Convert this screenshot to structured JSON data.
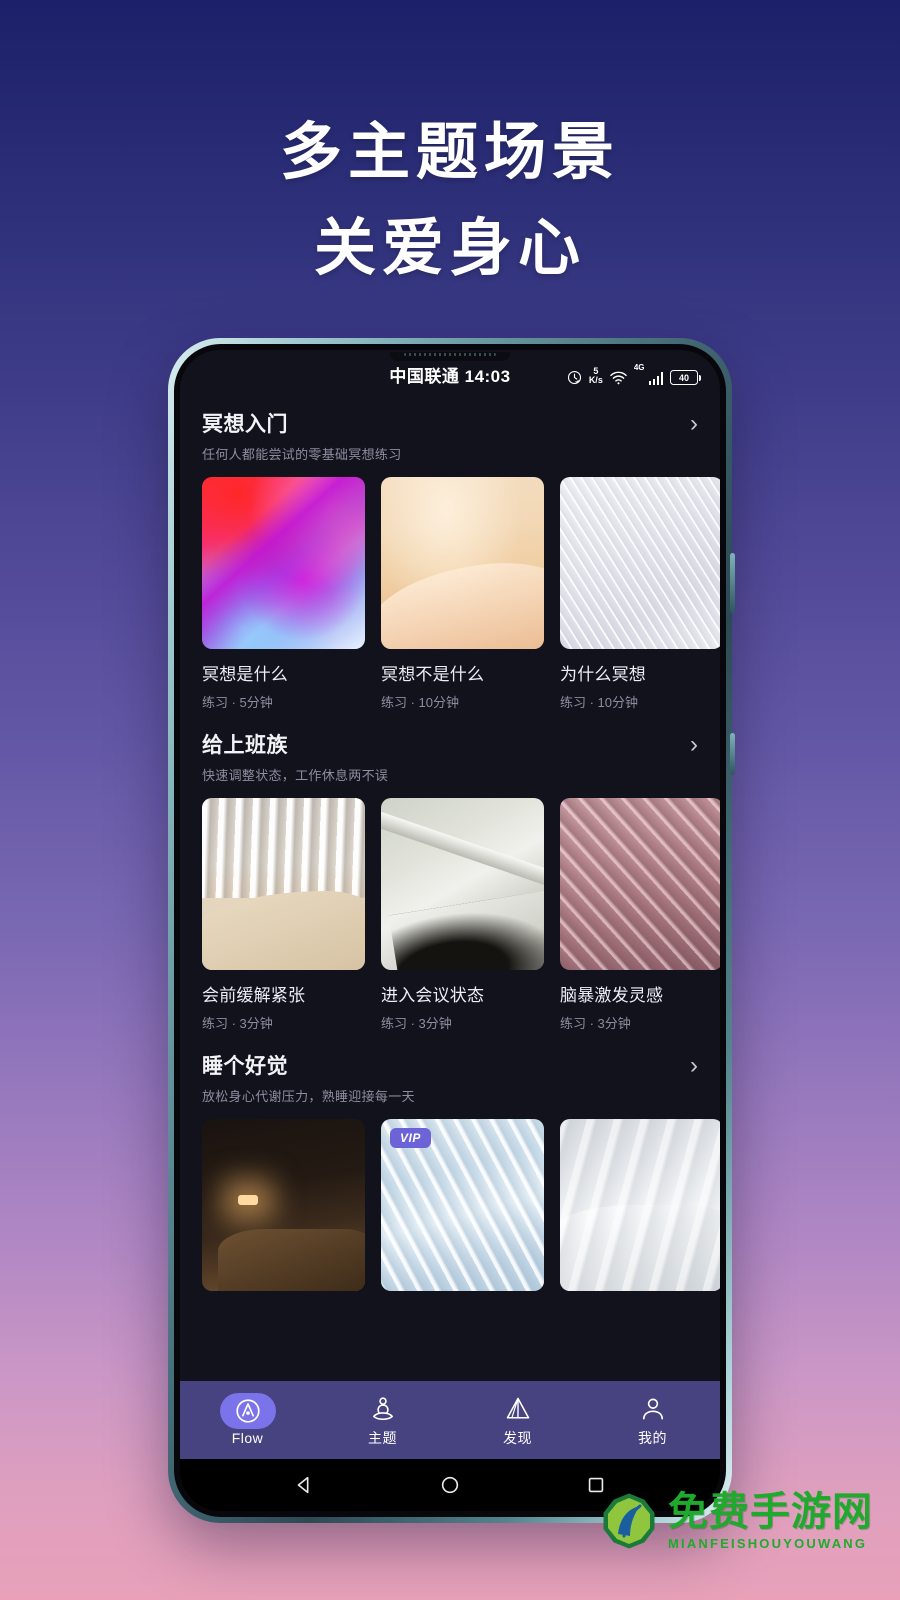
{
  "hero": {
    "line1": "多主题场景",
    "line2": "关爱身心"
  },
  "status_bar": {
    "carrier_time": "中国联通 14:03",
    "net_speed_value": "5",
    "net_speed_unit": "K/s",
    "network_type": "4G",
    "battery_level": "40"
  },
  "sections": [
    {
      "title": "冥想入门",
      "subtitle": "任何人都能尝试的零基础冥想练习",
      "cards": [
        {
          "title": "冥想是什么",
          "meta": "练习 · 5分钟",
          "art": "art-aurora",
          "vip": ""
        },
        {
          "title": "冥想不是什么",
          "meta": "练习 · 10分钟",
          "art": "art-sand",
          "vip": ""
        },
        {
          "title": "为什么冥想",
          "meta": "练习 · 10分钟",
          "art": "art-feather-white",
          "vip": ""
        }
      ]
    },
    {
      "title": "给上班族",
      "subtitle": "快速调整状态，工作休息两不误",
      "cards": [
        {
          "title": "会前缓解紧张",
          "meta": "练习 · 3分钟",
          "art": "art-curtain",
          "vip": ""
        },
        {
          "title": "进入会议状态",
          "meta": "练习 · 3分钟",
          "art": "art-stairs",
          "vip": ""
        },
        {
          "title": "脑暴激发灵感",
          "meta": "练习 · 3分钟",
          "art": "art-mauve",
          "vip": ""
        }
      ]
    },
    {
      "title": "睡个好觉",
      "subtitle": "放松身心代谢压力，熟睡迎接每一天",
      "cards": [
        {
          "title": "",
          "meta": "",
          "art": "art-bedroom",
          "vip": ""
        },
        {
          "title": "",
          "meta": "",
          "art": "art-quilt",
          "vip": "VIP"
        },
        {
          "title": "",
          "meta": "",
          "art": "art-bedwhite",
          "vip": ""
        }
      ]
    }
  ],
  "tabbar": {
    "items": [
      {
        "label": "Flow",
        "icon": "flow-icon",
        "active": true
      },
      {
        "label": "主题",
        "icon": "meditation-person-icon",
        "active": false
      },
      {
        "label": "发现",
        "icon": "prism-icon",
        "active": false
      },
      {
        "label": "我的",
        "icon": "person-icon",
        "active": false
      }
    ]
  },
  "android_nav": {
    "back": "back-triangle-icon",
    "home": "home-circle-icon",
    "recents": "recents-square-icon"
  },
  "watermark": {
    "cn": "免费手游网",
    "en": "MIANFEISHOUYOUWANG",
    "color": "#1faa2e"
  },
  "colors": {
    "bg_top": "#1b2069",
    "bg_mid": "#6257a5",
    "bg_bottom": "#e8a1b9",
    "app_bg": "#12121d",
    "tabbar_bg": "#474280",
    "accent": "#7b73ea",
    "vip_bg": "#6b63d6"
  }
}
